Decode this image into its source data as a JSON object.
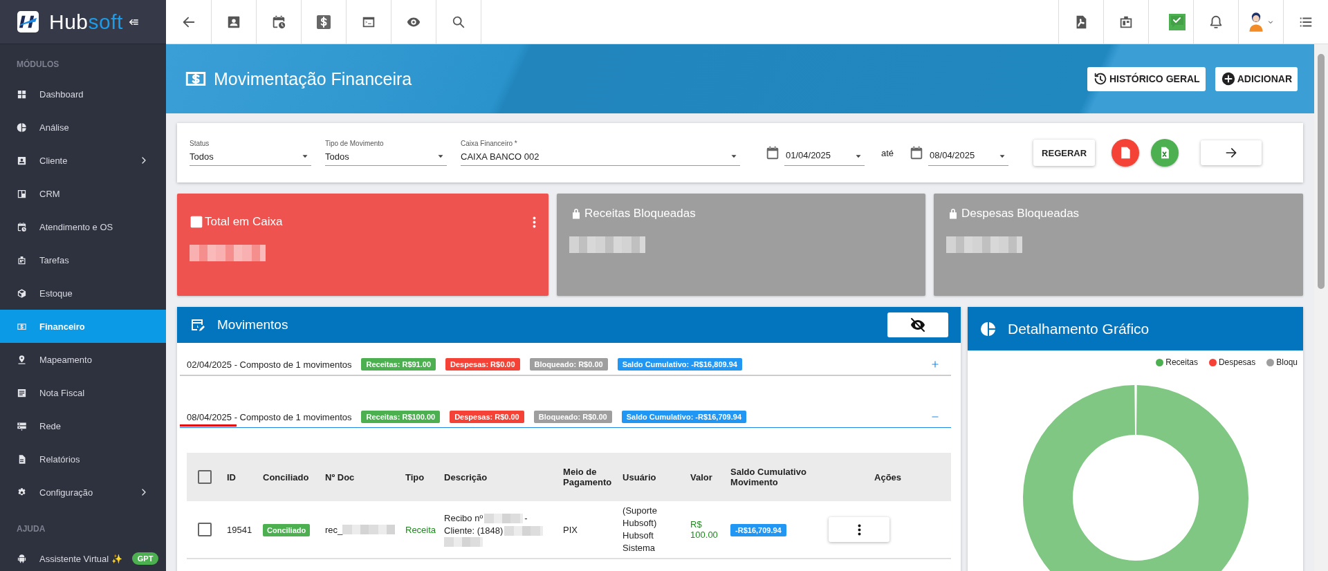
{
  "sidebar": {
    "brand": {
      "prefix": "Hub",
      "suffix": "soft"
    },
    "sections": [
      {
        "title": "MÓDULOS",
        "items": [
          {
            "label": "Dashboard",
            "selected": false,
            "has_submenu": false
          },
          {
            "label": "Análise",
            "selected": false,
            "has_submenu": false
          },
          {
            "label": "Cliente",
            "selected": false,
            "has_submenu": true
          },
          {
            "label": "CRM",
            "selected": false,
            "has_submenu": false
          },
          {
            "label": "Atendimento e OS",
            "selected": false,
            "has_submenu": false
          },
          {
            "label": "Tarefas",
            "selected": false,
            "has_submenu": false
          },
          {
            "label": "Estoque",
            "selected": false,
            "has_submenu": false
          },
          {
            "label": "Financeiro",
            "selected": true,
            "has_submenu": false
          },
          {
            "label": "Mapeamento",
            "selected": false,
            "has_submenu": false
          },
          {
            "label": "Nota Fiscal",
            "selected": false,
            "has_submenu": false
          },
          {
            "label": "Rede",
            "selected": false,
            "has_submenu": false
          },
          {
            "label": "Relatórios",
            "selected": false,
            "has_submenu": false
          },
          {
            "label": "Configuração",
            "selected": false,
            "has_submenu": true
          }
        ]
      },
      {
        "title": "AJUDA",
        "items": [
          {
            "label": "Assistente Virtual ✨",
            "selected": false,
            "has_submenu": false,
            "badge": "GPT"
          }
        ]
      }
    ]
  },
  "header": {
    "title": "Movimentação Financeira",
    "buttons": [
      "HISTÓRICO GERAL",
      "ADICIONAR"
    ]
  },
  "filters": {
    "selects": [
      {
        "label": "Status",
        "value": "Todos"
      },
      {
        "label": "Tipo de Movimento",
        "value": "Todos"
      },
      {
        "label": "Caixa Financeiro *",
        "value": "CAIXA BANCO 002"
      }
    ],
    "date_from": "01/04/2025",
    "separator": "até",
    "date_to": "08/04/2025",
    "regenerate": "REGERAR"
  },
  "cards": [
    {
      "kind": "balance",
      "title": "Total em Caixa",
      "color": "#ef5350"
    },
    {
      "kind": "locked",
      "title": "Receitas Bloqueadas",
      "color": "#9e9e9e"
    },
    {
      "kind": "locked",
      "title": "Despesas Bloqueadas",
      "color": "#9e9e9e"
    }
  ],
  "movements": {
    "title": "Movimentos",
    "groups": [
      {
        "date": "02/04/2025",
        "summary": " - Composto de 1 movimentos",
        "expanded": false,
        "underlined": false,
        "badges": [
          {
            "text": "Receitas: R$91.00",
            "color": "#4caf50"
          },
          {
            "text": "Despesas: R$0.00",
            "color": "#f44336"
          },
          {
            "text": "Bloqueado: R$0.00",
            "color": "#9e9e9e"
          },
          {
            "text": "Saldo Cumulativo: -R$16,809.94",
            "color": "#2196f3"
          }
        ]
      },
      {
        "date": "08/04/2025",
        "summary": " - Composto de 1 movimentos",
        "expanded": true,
        "underlined": true,
        "badges": [
          {
            "text": "Receitas: R$100.00",
            "color": "#4caf50"
          },
          {
            "text": "Despesas: R$0.00",
            "color": "#f44336"
          },
          {
            "text": "Bloqueado: R$0.00",
            "color": "#9e9e9e"
          },
          {
            "text": "Saldo Cumulativo: -R$16,709.94",
            "color": "#2196f3"
          }
        ]
      }
    ],
    "table": {
      "all_selected": false,
      "columns": [
        "ID",
        "Conciliado",
        "Nº Doc",
        "Tipo",
        "Descrição",
        "Meio de Pagamento",
        "Usuário",
        "Valor",
        "Saldo Cumulativo Movimento",
        "Ações"
      ],
      "rows": [
        {
          "checked": false,
          "id": "19541",
          "status": "Conciliado",
          "doc": "rec_",
          "type": "Receita",
          "description": [
            {
              "kind": "text",
              "text": "Recibo nº"
            },
            {
              "kind": "redacted"
            },
            {
              "kind": "text",
              "text": "-"
            },
            {
              "kind": "text",
              "text": "Cliente: (1848)"
            },
            {
              "kind": "redacted"
            },
            {
              "kind": "redacted"
            }
          ],
          "payment": "PIX",
          "user": "(Suporte Hubsoft) Hubsoft Sistema",
          "value": "R$ 100.00",
          "balance": "-R$16,709.94"
        }
      ]
    }
  },
  "chart": {
    "title": "Detalhamento Gráfico",
    "legend": [
      {
        "label": "Receitas",
        "color": "#4caf50"
      },
      {
        "label": "Despesas",
        "color": "#f44336"
      },
      {
        "label": "Bloqu",
        "color": "#9e9e9e"
      }
    ]
  }
}
